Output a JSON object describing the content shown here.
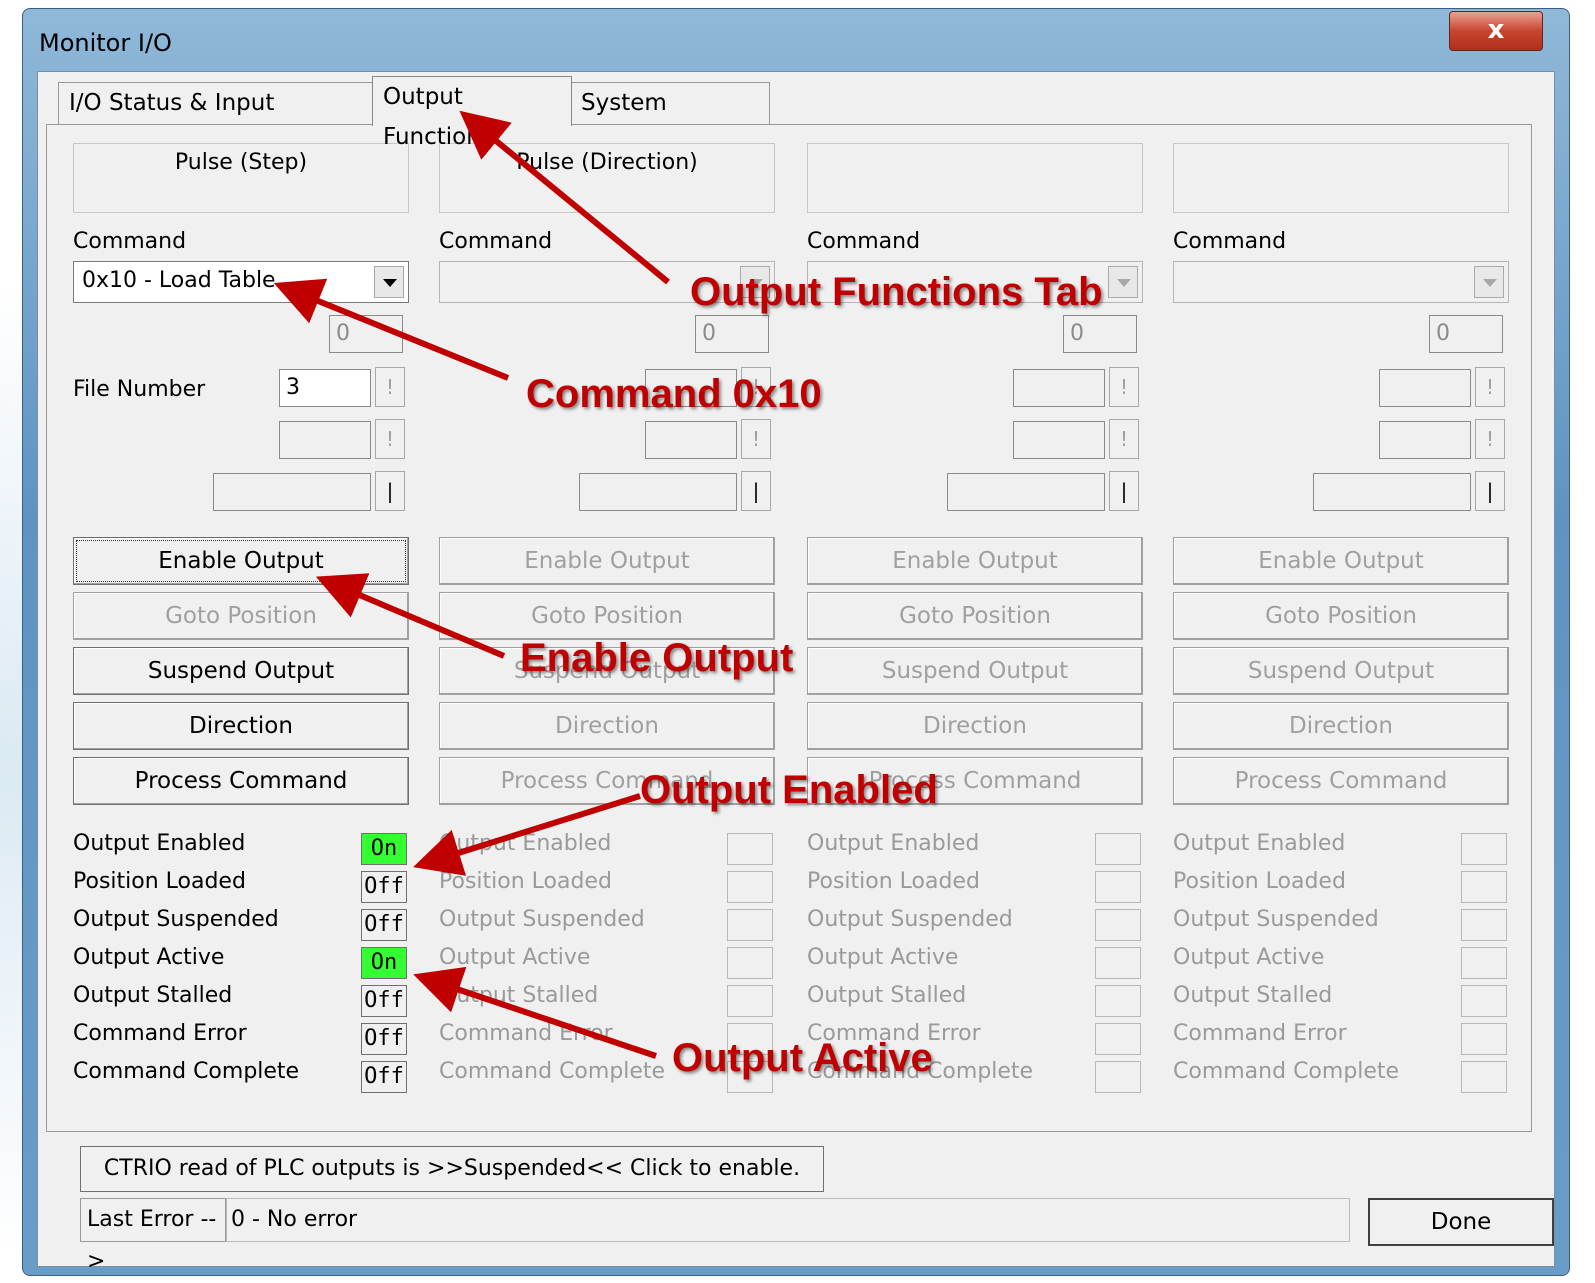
{
  "window": {
    "title": "Monitor I/O",
    "close_glyph": "x"
  },
  "tabs": [
    {
      "label": "I/O Status & Input Functions"
    },
    {
      "label": "Output Functions"
    },
    {
      "label": "System Functions"
    }
  ],
  "columns": [
    {
      "header": "Pulse (Step)",
      "command_label": "Command",
      "command_value": "0x10 - Load Table",
      "param_value": "0",
      "file_label": "File Number",
      "file_value": "3"
    },
    {
      "header": "Pulse (Direction)",
      "command_label": "Command",
      "command_value": "",
      "param_value": "0",
      "file_label": "",
      "file_value": ""
    },
    {
      "header": "",
      "command_label": "Command",
      "command_value": "",
      "param_value": "0",
      "file_label": "",
      "file_value": ""
    },
    {
      "header": "",
      "command_label": "Command",
      "command_value": "",
      "param_value": "0",
      "file_label": "",
      "file_value": ""
    }
  ],
  "small_button_glyphs": {
    "bang": "!",
    "bar": "|"
  },
  "buttons": [
    "Enable Output",
    "Goto Position",
    "Suspend Output",
    "Direction",
    "Process Command"
  ],
  "status_labels": [
    "Output Enabled",
    "Position Loaded",
    "Output Suspended",
    "Output Active",
    "Output Stalled",
    "Command Error",
    "Command Complete"
  ],
  "status_values": [
    "On",
    "Off",
    "Off",
    "On",
    "Off",
    "Off",
    "Off"
  ],
  "status_on_color": "#33ff33",
  "ctrio_button": "CTRIO read of PLC outputs is >>Suspended<< Click to enable.",
  "last_error_label": "Last Error -->",
  "last_error_value": "0 - No error",
  "done_button": "Done",
  "annotations": {
    "tab": "Output Functions Tab",
    "command": "Command 0x10",
    "enable": "Enable Output",
    "enabled": "Output Enabled",
    "active": "Output Active"
  },
  "annotation_color": "#c00000"
}
